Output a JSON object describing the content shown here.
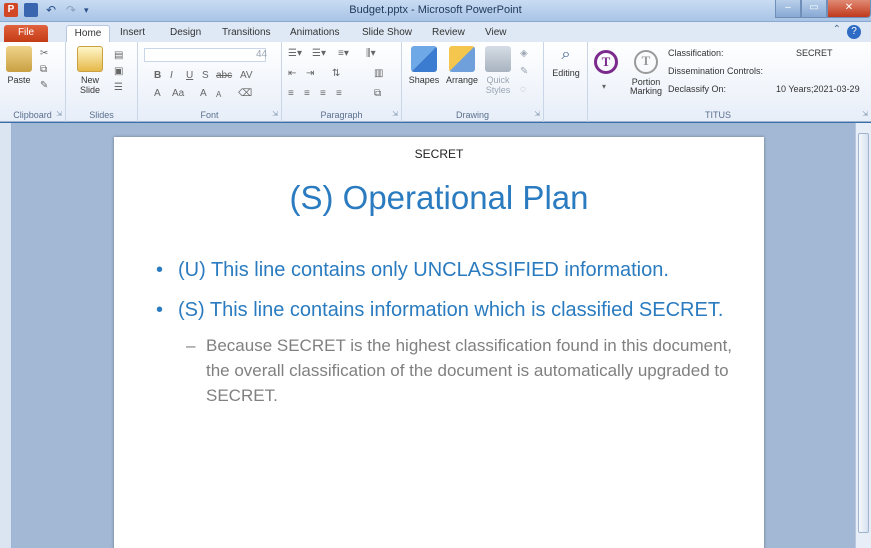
{
  "window": {
    "title": "Budget.pptx - Microsoft PowerPoint",
    "app_icon_label": "P",
    "min_label": "–",
    "max_label": "▭",
    "close_label": "✕"
  },
  "tabs": [
    "File",
    "Home",
    "Insert",
    "Design",
    "Transitions",
    "Animations",
    "Slide Show",
    "Review",
    "View"
  ],
  "ribbon": {
    "clipboard": {
      "label": "Clipboard",
      "paste": "Paste"
    },
    "slides": {
      "label": "Slides",
      "new_slide": "New Slide"
    },
    "font": {
      "label": "Font",
      "size": "44"
    },
    "paragraph": {
      "label": "Paragraph"
    },
    "drawing": {
      "label": "Drawing",
      "shapes": "Shapes",
      "arrange": "Arrange",
      "quick_styles": "Quick Styles"
    },
    "editing": {
      "label": "Editing"
    },
    "titus": {
      "label": "TITUS",
      "portion_marking": "Portion Marking",
      "classification_label": "Classification:",
      "classification_value": "SECRET",
      "dissemination_label": "Dissemination Controls:",
      "declassify_label": "Declassify On:",
      "declassify_value": "10 Years;2021-03-29"
    }
  },
  "slide": {
    "marking": "SECRET",
    "title": "(S) Operational Plan",
    "bullets": [
      {
        "text": "(U) This line contains only UNCLASSIFIED information."
      },
      {
        "text": "(S) This line contains information which is classified SECRET."
      }
    ],
    "sub_bullet": "Because SECRET is the highest classification found in this document, the overall classification of the document is automatically upgraded to SECRET."
  },
  "colors": {
    "accent_blue": "#2a7bbf",
    "file_tab": "#c43c16",
    "titus_purple": "#7b2b8c"
  }
}
